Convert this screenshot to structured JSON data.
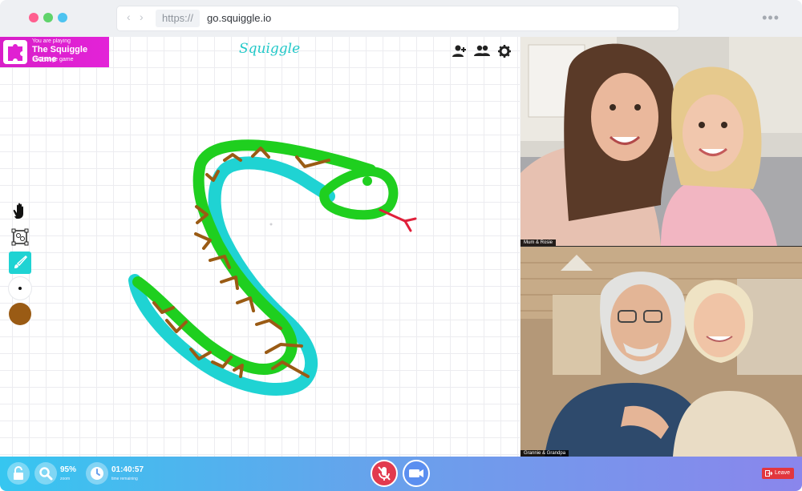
{
  "browser": {
    "scheme": "https://",
    "host": "go.squiggle.io",
    "more_glyph": "•••",
    "back_glyph": "‹",
    "forward_glyph": "›"
  },
  "game": {
    "playing_label": "You are playing",
    "name": "The Squiggle Game",
    "change_label": "⤨ Change game"
  },
  "brand": "Squiggle",
  "toolbar_icons": [
    "add-user-icon",
    "users-icon",
    "gear-icon"
  ],
  "tools": [
    {
      "name": "hand-tool",
      "icon": "hand-icon"
    },
    {
      "name": "select-tool",
      "icon": "select-icon"
    },
    {
      "name": "brush-tool",
      "icon": "brush-icon",
      "active": true
    },
    {
      "name": "brush-size",
      "icon": "dot-icon"
    },
    {
      "name": "color-swatch",
      "color": "#9a5b14"
    }
  ],
  "drawing_colors": {
    "outline": "#1fd3d3",
    "body": "#1fcf1f",
    "pattern": "#9a5b14",
    "tongue": "#e0203a"
  },
  "videos": [
    {
      "label": "Mum & Rosie"
    },
    {
      "label": "Grannie & Grandpa"
    }
  ],
  "bottom": {
    "zoom_value": "95%",
    "zoom_label": "zoom",
    "time_value": "01:40:57",
    "time_label": "time remaining",
    "leave_label": "Leave"
  },
  "colors": {
    "badge": "#e020d2",
    "accent": "#21c8c8",
    "mic_muted": "#e23a4e",
    "leave": "#e2363e"
  }
}
